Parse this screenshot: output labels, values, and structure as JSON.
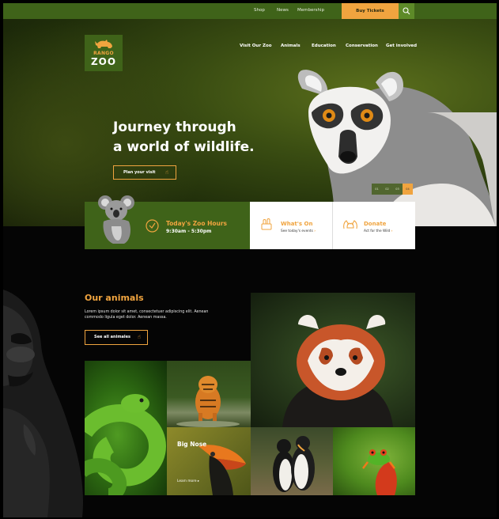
{
  "topbar": {
    "links": [
      "Shop",
      "News",
      "Membership"
    ],
    "tickets_label": "Buy Tickets"
  },
  "logo": {
    "line1": "RANGO",
    "line2": "ZOO"
  },
  "nav": [
    "Visit Our Zoo",
    "Animals",
    "Education",
    "Conservation",
    "Get involved"
  ],
  "hero": {
    "headline_1": "Journey through",
    "headline_2": "a world of wildlife.",
    "cta_label": "Plan your visit",
    "slides": [
      "01",
      "02",
      "03",
      "04"
    ],
    "active_slide": 4
  },
  "info": {
    "hours_title": "Today's Zoo Hours",
    "hours_value": "9:30am - 5:30pm",
    "whats_on_title": "What's On",
    "whats_on_sub": "See today's events",
    "donate_title": "Donate",
    "donate_sub": "Act for the Wild"
  },
  "animals": {
    "title": "Our animals",
    "desc": "Lorem ipsum dolor sit amet, consectetuer adipiscing elit. Aenean commodo ligula eget dolor. Aenean massa.",
    "button_label": "See all animales",
    "featured_title": "Big Nose",
    "featured_link": "Learn more"
  },
  "colors": {
    "green": "#3f6319",
    "orange": "#f0a43f"
  }
}
